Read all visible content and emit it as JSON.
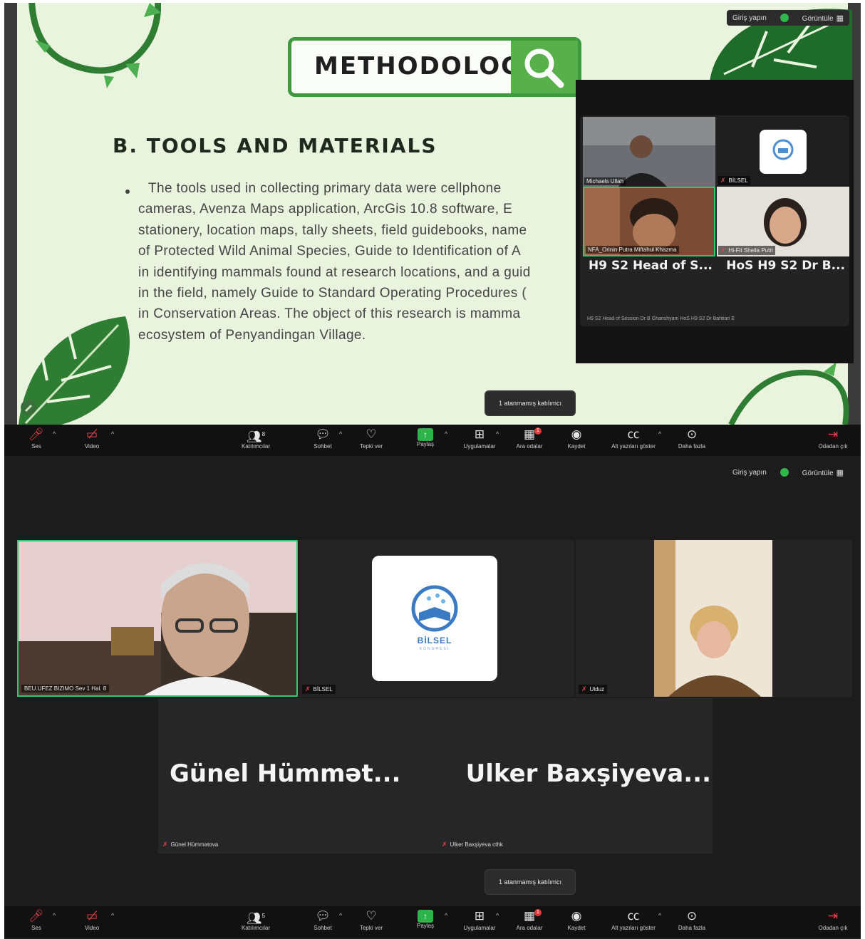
{
  "top_window": {
    "slide": {
      "title": "METHODOLOGY",
      "section_title": "B. TOOLS AND MATERIALS",
      "body_lines": [
        "The tools used in collecting primary data were cellphone",
        "cameras, Avenza Maps application, ArcGis 10.8 software, E",
        "stationery, location maps, tally sheets, field guidebooks, name",
        "of Protected Wild Animal Species, Guide to Identification of A",
        "in identifying mammals found at research locations, and a guid",
        "in the field, namely Guide to Standard Operating Procedures (",
        "in Conservation Areas. The object of this research is mamma",
        "ecosystem of Penyandingan Village."
      ]
    },
    "header": {
      "sign_in": "Giriş yapın",
      "view": "Görüntüle"
    },
    "floating_gallery": {
      "tiles": [
        {
          "name": "Michaels Ullah"
        },
        {
          "name": "BİLSEL"
        },
        {
          "name": "NFA_Orinin Putra Miftahul Khazma"
        },
        {
          "name": "Hi-Fit Sheila Putri"
        }
      ],
      "big_names": [
        "H9 S2 Head of S...",
        "HoS H9 S2 Dr B..."
      ],
      "small_names": "H9 S2 Head of Session Dr B Ghanshyam  HoS H9 S2 Dr Bahtiari E"
    },
    "tooltip": "1 atanmamış katılımcı",
    "toolbar": {
      "items": [
        {
          "label": "Ses",
          "icon": "microphone-muted-icon"
        },
        {
          "label": "Video",
          "icon": "video-off-icon"
        },
        {
          "label": "Katılımcılar",
          "icon": "participants-icon",
          "count": "8"
        },
        {
          "label": "Sohbet",
          "icon": "chat-icon"
        },
        {
          "label": "Tepki ver",
          "icon": "reaction-icon"
        },
        {
          "label": "Paylaş",
          "icon": "share-screen-icon"
        },
        {
          "label": "Uygulamalar",
          "icon": "apps-icon"
        },
        {
          "label": "Ara odalar",
          "icon": "breakout-rooms-icon",
          "badge": "1"
        },
        {
          "label": "Kaydet",
          "icon": "record-icon"
        },
        {
          "label": "Alt yazıları göster",
          "icon": "captions-icon"
        },
        {
          "label": "Daha fazla",
          "icon": "more-icon"
        },
        {
          "label": "Odadan çık",
          "icon": "leave-room-icon"
        }
      ]
    }
  },
  "bottom_window": {
    "header": {
      "sign_in": "Giriş yapın",
      "view": "Görüntüle"
    },
    "tiles": [
      {
        "name": "BEU.UFEZ BIZIMO Sev 1 Hal. 8"
      },
      {
        "name": "BİLSEL",
        "logo_text": "BİLSEL",
        "logo_sub": "KONGRESİ"
      },
      {
        "name": "Ulduz"
      }
    ],
    "name_tile": {
      "big_names": [
        "Günel Hümmət...",
        "Ulker Baxşiyeva..."
      ],
      "labels": [
        "Günel Hümmətova",
        "Ulker Baxşiyeva cthk"
      ]
    },
    "tooltip": "1 atanmamış katılımcı",
    "toolbar": {
      "items": [
        {
          "label": "Ses",
          "icon": "microphone-muted-icon"
        },
        {
          "label": "Video",
          "icon": "video-off-icon"
        },
        {
          "label": "Katılımcılar",
          "icon": "participants-icon",
          "count": "5"
        },
        {
          "label": "Sohbet",
          "icon": "chat-icon"
        },
        {
          "label": "Tepki ver",
          "icon": "reaction-icon"
        },
        {
          "label": "Paylaş",
          "icon": "share-screen-icon"
        },
        {
          "label": "Uygulamalar",
          "icon": "apps-icon"
        },
        {
          "label": "Ara odalar",
          "icon": "breakout-rooms-icon",
          "badge": "1"
        },
        {
          "label": "Kaydet",
          "icon": "record-icon"
        },
        {
          "label": "Alt yazıları göster",
          "icon": "captions-icon"
        },
        {
          "label": "Daha fazla",
          "icon": "more-icon"
        },
        {
          "label": "Odadan çık",
          "icon": "leave-room-icon"
        }
      ]
    }
  },
  "colors": {
    "accent_green": "#31c96f",
    "muted_red": "#e5434b",
    "slide_bg": "#e9f3de",
    "slide_green": "#3f9a3f"
  }
}
